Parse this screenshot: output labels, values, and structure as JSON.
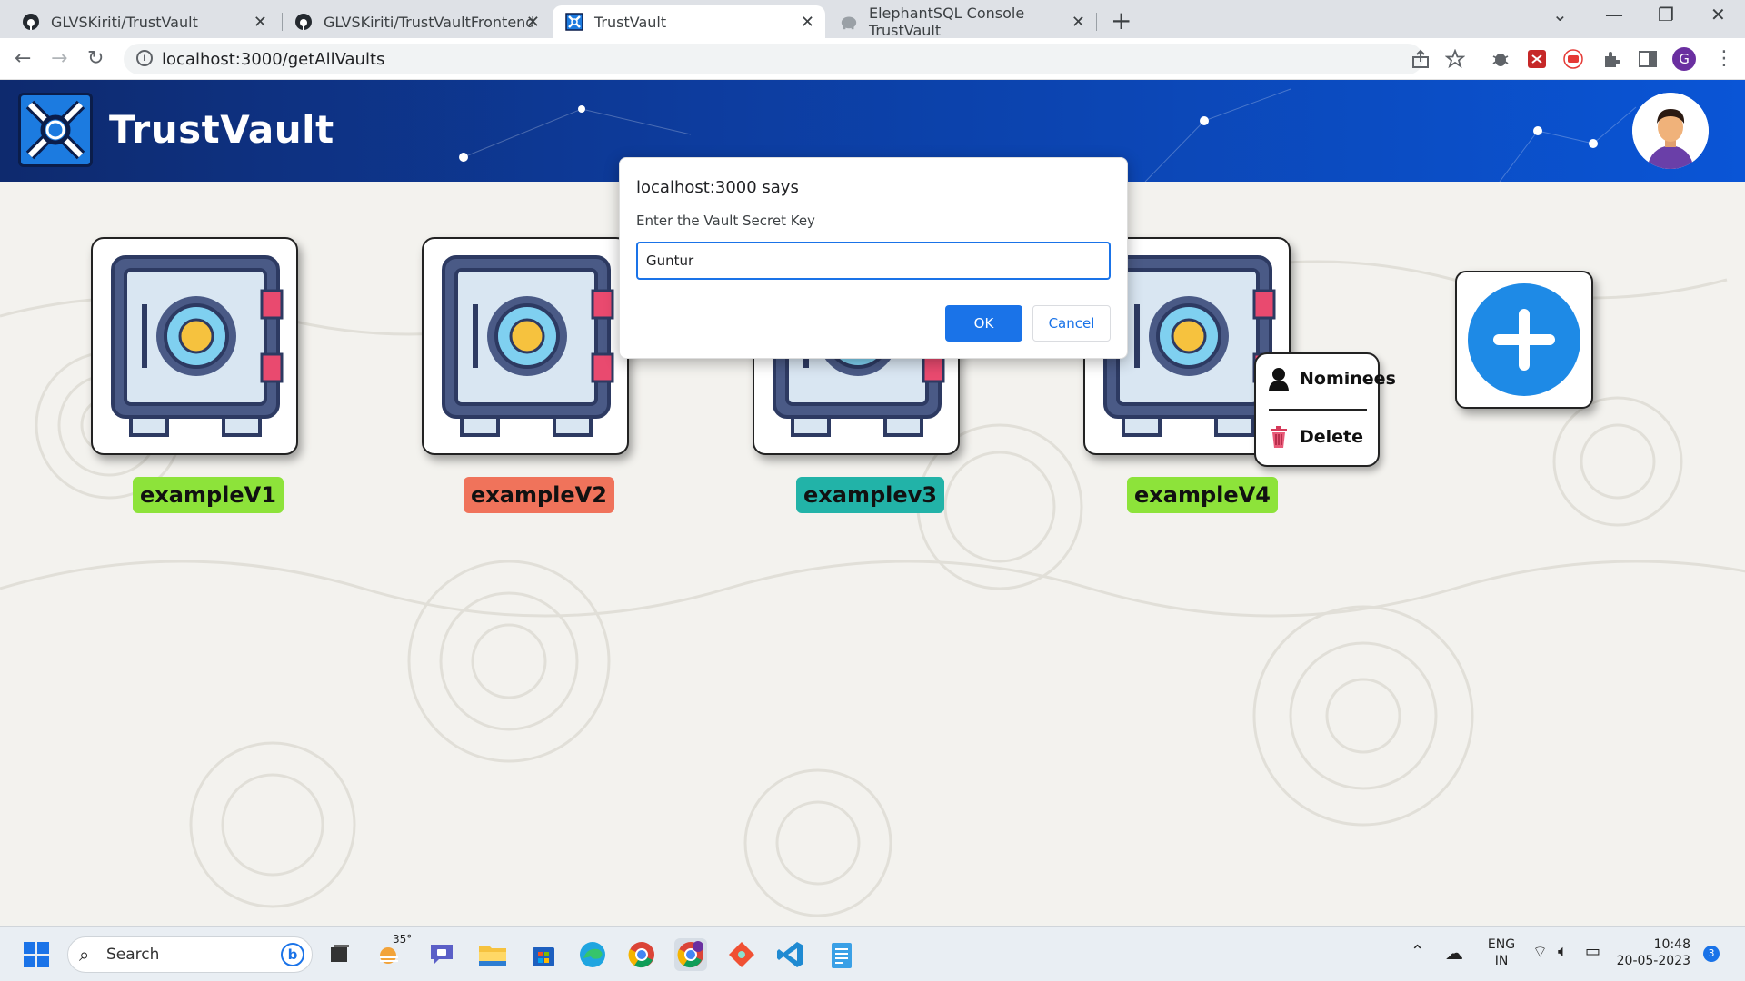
{
  "browser": {
    "tabs": [
      {
        "title": "GLVSKiriti/TrustVault",
        "icon": "github-icon",
        "active": false
      },
      {
        "title": "GLVSKiriti/TrustVaultFrontend",
        "icon": "github-icon",
        "active": false
      },
      {
        "title": "TrustVault",
        "icon": "trustvault-icon",
        "active": true
      },
      {
        "title": "ElephantSQL Console TrustVault",
        "icon": "elephant-icon",
        "active": false
      }
    ],
    "url": "localhost:3000/getAllVaults",
    "profile_initial": "G"
  },
  "app": {
    "brand": "TrustVault",
    "vaults": [
      {
        "name": "exampleV1",
        "label_color": "#8de33a"
      },
      {
        "name": "exampleV2",
        "label_color": "#f0735b"
      },
      {
        "name": "examplev3",
        "label_color": "#22b3a8"
      },
      {
        "name": "exampleV4",
        "label_color": "#8de33a"
      }
    ],
    "context_menu": {
      "nominees": "Nominees",
      "delete": "Delete"
    }
  },
  "dialog": {
    "title": "localhost:3000 says",
    "message": "Enter the Vault Secret Key",
    "input_value": "Guntur",
    "ok": "OK",
    "cancel": "Cancel"
  },
  "taskbar": {
    "search_placeholder": "Search",
    "weather": "35°",
    "lang_top": "ENG",
    "lang_bottom": "IN",
    "time": "10:48",
    "date": "20-05-2023",
    "notifications": "3"
  }
}
